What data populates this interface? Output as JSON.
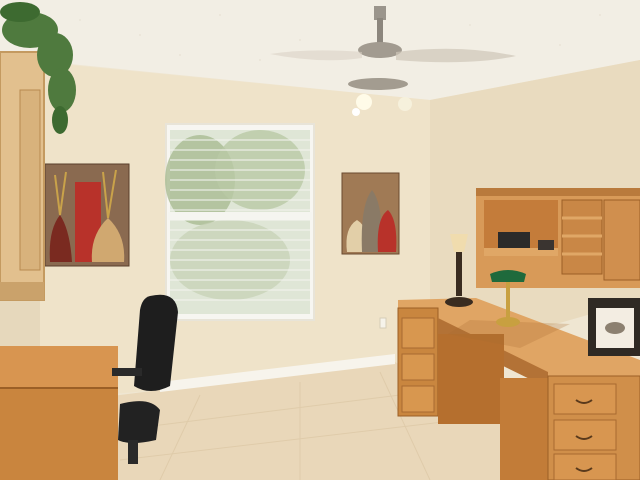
{
  "scene": {
    "colors": {
      "wall": "#efe4cc",
      "wall_shadow": "#e2d4b8",
      "ceiling": "#f3efe6",
      "floor": "#e8d6b8",
      "baseboard": "#f6f3ea",
      "wood": "#c98a4a",
      "wood_dark": "#a86a30",
      "window_light": "#f2f4ee",
      "greenery": "#6f8f5a",
      "accent_red": "#b8322a"
    },
    "icons": {
      "ceiling_fan": "ceiling-fan-icon",
      "chair": "office-chair-icon",
      "lamp": "desk-lamp-icon",
      "bankers_lamp": "bankers-lamp-icon",
      "photo_frame": "photo-frame-icon",
      "plant": "plant-icon"
    }
  }
}
